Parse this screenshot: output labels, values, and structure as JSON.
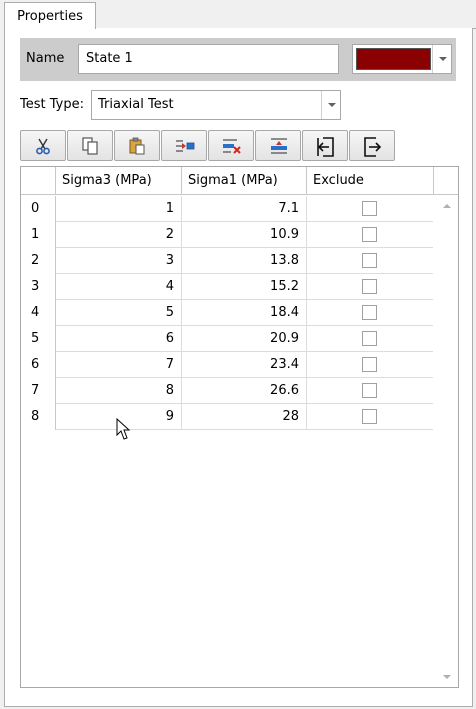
{
  "tab": {
    "label": "Properties"
  },
  "name_row": {
    "label": "Name",
    "value": "State 1",
    "color": "#8b0000"
  },
  "test_type": {
    "label": "Test Type:",
    "value": "Triaxial Test"
  },
  "toolbar": {
    "buttons": [
      {
        "icon": "cut-icon"
      },
      {
        "icon": "copy-icon"
      },
      {
        "icon": "paste-icon"
      },
      {
        "icon": "insert-row-icon"
      },
      {
        "icon": "delete-row-icon"
      },
      {
        "icon": "add-row-icon"
      },
      {
        "icon": "import-icon"
      },
      {
        "icon": "export-icon"
      }
    ]
  },
  "table": {
    "columns": [
      "Sigma3 (MPa)",
      "Sigma1 (MPa)",
      "Exclude"
    ],
    "rows": [
      {
        "index": "0",
        "sigma3": "1",
        "sigma1": "7.1",
        "exclude": false
      },
      {
        "index": "1",
        "sigma3": "2",
        "sigma1": "10.9",
        "exclude": false
      },
      {
        "index": "2",
        "sigma3": "3",
        "sigma1": "13.8",
        "exclude": false
      },
      {
        "index": "3",
        "sigma3": "4",
        "sigma1": "15.2",
        "exclude": false
      },
      {
        "index": "4",
        "sigma3": "5",
        "sigma1": "18.4",
        "exclude": false
      },
      {
        "index": "5",
        "sigma3": "6",
        "sigma1": "20.9",
        "exclude": false
      },
      {
        "index": "6",
        "sigma3": "7",
        "sigma1": "23.4",
        "exclude": false
      },
      {
        "index": "7",
        "sigma3": "8",
        "sigma1": "26.6",
        "exclude": false
      },
      {
        "index": "8",
        "sigma3": "9",
        "sigma1": "28",
        "exclude": false
      }
    ]
  }
}
